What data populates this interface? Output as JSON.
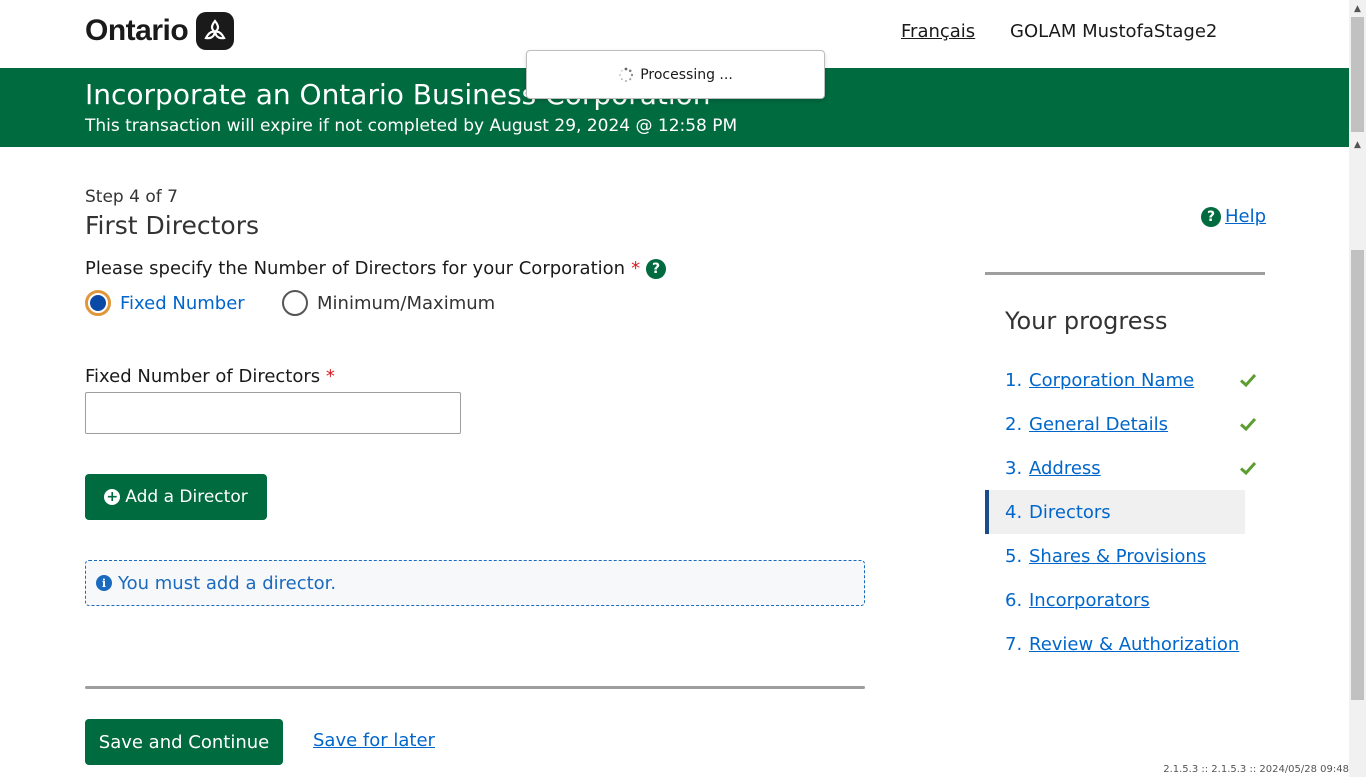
{
  "header": {
    "logo_text": "Ontario",
    "language_link": "Français",
    "user_name": "GOLAM MustofaStage2"
  },
  "banner": {
    "title": "Incorporate an Ontario Business Corporation",
    "subtitle": "This transaction will expire if not completed by August 29, 2024 @ 12:58 PM"
  },
  "processing": {
    "label": "Processing ..."
  },
  "main": {
    "step": "Step 4 of 7",
    "title": "First Directors",
    "help_label": "Help",
    "question": "Please specify the Number of Directors for your Corporation",
    "required_mark": "*",
    "options": [
      {
        "label": "Fixed Number",
        "selected": true
      },
      {
        "label": "Minimum/Maximum",
        "selected": false
      }
    ],
    "fixed_number_label": "Fixed Number of Directors",
    "fixed_number_value": "",
    "add_director_label": "Add a Director",
    "info_message": "You must add a director.",
    "save_continue_label": "Save and Continue",
    "save_later_label": "Save for later"
  },
  "progress": {
    "title": "Your progress",
    "steps": [
      {
        "num": "1.",
        "label": "Corporation Name",
        "complete": true
      },
      {
        "num": "2.",
        "label": "General Details",
        "complete": true
      },
      {
        "num": "3.",
        "label": "Address",
        "complete": true
      },
      {
        "num": "4.",
        "label": "Directors",
        "current": true
      },
      {
        "num": "5.",
        "label": "Shares & Provisions"
      },
      {
        "num": "6.",
        "label": "Incorporators"
      },
      {
        "num": "7.",
        "label": "Review & Authorization"
      }
    ]
  },
  "footer": {
    "version": "2.1.5.3 :: 2.1.5.3 :: 2024/05/28 09:48"
  },
  "colors": {
    "brand_green": "#006b3f",
    "link_blue": "#0066cc",
    "required_red": "#d81a21",
    "check_green": "#5c9e31"
  }
}
